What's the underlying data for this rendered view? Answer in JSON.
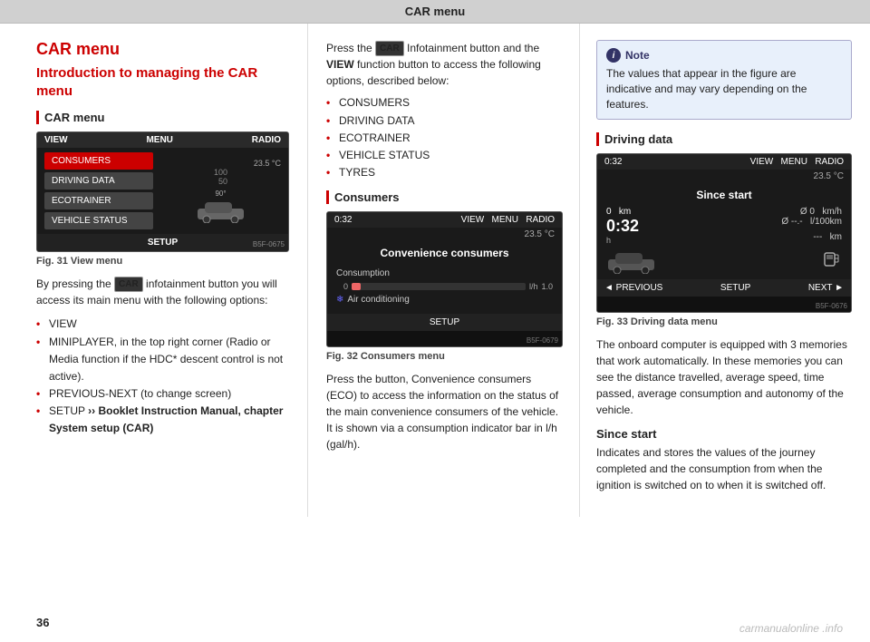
{
  "topbar": {
    "title": "CAR menu"
  },
  "left": {
    "main_title": "CAR menu",
    "subtitle": "Introduction to managing the CAR menu",
    "section_label": "CAR menu",
    "fig31_label": "Fig. 31",
    "fig31_text": "View menu",
    "body1": "By pressing the",
    "car_badge": "CAR",
    "body2": "infotainment button you will access its main menu with the following options:",
    "bullets": [
      "VIEW",
      "MINIPLAYER, in the top right corner (Radio or Media function if the HDC* descent control is not active).",
      "PREVIOUS-NEXT (to change screen)",
      "SETUP"
    ],
    "setup_bold": "Booklet Instruction Manual, chapter System setup (CAR)",
    "screen_topbar": {
      "view": "VIEW",
      "menu": "MENU",
      "radio": "RADIO"
    },
    "screen_buttons": [
      "CONSUMERS",
      "DRIVING DATA",
      "ECOTRAINER",
      "VEHICLE STATUS"
    ],
    "screen_bottom": "SETUP",
    "bsf": "B5F-0675"
  },
  "middle": {
    "intro": "Press the",
    "car_badge": "CAR",
    "intro2": "Infotainment button and the",
    "view_label": "VIEW",
    "intro3": "function button to access the following options, described below:",
    "bullets": [
      "CONSUMERS",
      "DRIVING DATA",
      "ECOTRAINER",
      "VEHICLE STATUS",
      "TYRES"
    ],
    "section_label": "Consumers",
    "fig32_label": "Fig. 32",
    "fig32_text": "Consumers menu",
    "cons_screen": {
      "topbar_left": "0:32",
      "topbar_center_v": "VIEW",
      "topbar_center_m": "MENU",
      "topbar_center_r": "RADIO",
      "temp": "23.5 °C",
      "title": "Convenience consumers",
      "row1_label": "Consumption",
      "row1_left": "0",
      "row1_right": "l/h",
      "row1_val": "1.0",
      "row2_label": "Air conditioning",
      "bottom": "SETUP"
    },
    "bsf": "B5F-0679",
    "body": "Press the button, Convenience consumers (ECO) to access the information on the status of the main convenience consumers of the vehicle. It is shown via a consumption indicator bar in l/h (gal/h)."
  },
  "right": {
    "note_title": "Note",
    "note_text": "The values that appear in the figure are indicative and may vary depending on the features.",
    "section_label": "Driving data",
    "fig33_label": "Fig. 33",
    "fig33_text": "Driving data menu",
    "drv_screen": {
      "topbar_left": "0:32",
      "topbar_v": "VIEW",
      "topbar_m": "MENU",
      "topbar_r": "RADIO",
      "temp": "23.5 °C",
      "title": "Since start",
      "stat1_label": "0  km",
      "stat1_val": "Ø 0  km/h",
      "stat2_label": "0:32  h",
      "stat2_val": "Ø --.-  l/100km",
      "stat3_val": "---  km",
      "prev": "◄ PREVIOUS",
      "setup": "SETUP",
      "next": "NEXT ►"
    },
    "bsf": "B5F-0676",
    "body1": "The onboard computer is equipped with 3 memories that work automatically. In these memories you can see the distance travelled, average speed, time passed, average consumption and autonomy of the vehicle.",
    "since_start_title": "Since start",
    "since_start_body": "Indicates and stores the values of the journey completed and the consumption from when the ignition is switched on to when it is switched off."
  },
  "page_number": "36",
  "watermark": "carmanualonline .info"
}
